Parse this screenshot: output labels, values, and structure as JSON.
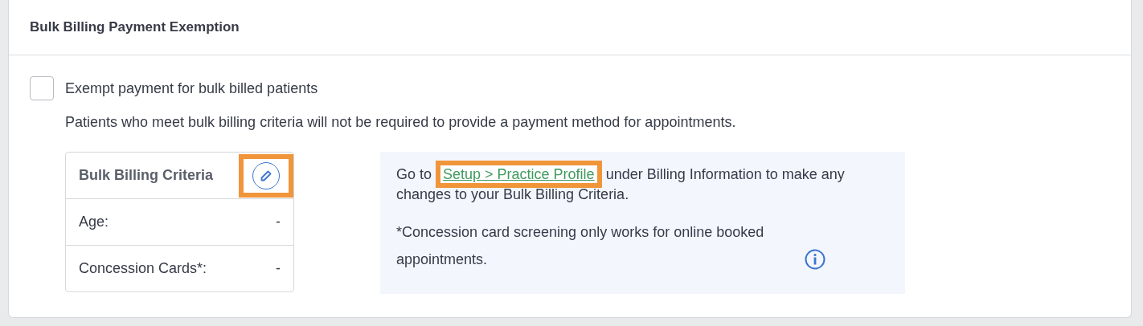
{
  "card": {
    "title": "Bulk Billing Payment Exemption"
  },
  "exempt": {
    "label": "Exempt payment for bulk billed patients",
    "checked": false,
    "description": "Patients who meet bulk billing criteria will not be required to provide a payment method for appointments."
  },
  "criteria": {
    "title": "Bulk Billing Criteria",
    "edit_highlighted": true,
    "rows": [
      {
        "label": "Age:",
        "value": "-"
      },
      {
        "label": "Concession Cards*:",
        "value": "-"
      }
    ]
  },
  "info": {
    "before": "Go to ",
    "link": "Setup > Practice Profile",
    "link_highlighted": true,
    "after": " under Billing Information to make any changes to your Bulk Billing Criteria.",
    "note": "*Concession card screening only works for online booked appointments."
  }
}
